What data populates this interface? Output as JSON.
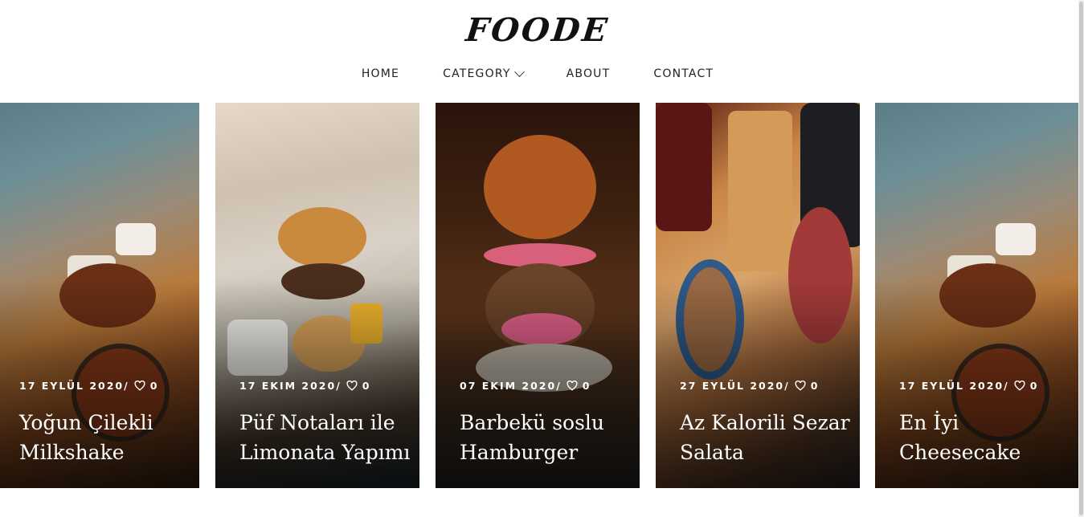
{
  "brand": {
    "logo_text": "FOODE"
  },
  "nav": {
    "items": [
      {
        "label": "HOME"
      },
      {
        "label": "CATEGORY",
        "has_dropdown": true
      },
      {
        "label": "ABOUT"
      },
      {
        "label": "CONTACT"
      }
    ]
  },
  "posts": [
    {
      "date": "17 EYLÜL 2020/",
      "likes": "0",
      "title": "Yoğun Çilekli Milkshake",
      "image": "grilled-steak-platter"
    },
    {
      "date": "17 EKIM 2020/",
      "likes": "0",
      "title": "Püf Notaları ile Limonata Yapımı",
      "image": "burger-with-fries"
    },
    {
      "date": "07 EKIM 2020/",
      "likes": "0",
      "title": "Barbekü soslu Hamburger",
      "image": "tall-burger"
    },
    {
      "date": "27 EYLÜL 2020/",
      "likes": "0",
      "title": "Az Kalorili Sezar Salata",
      "image": "charcuterie-board"
    },
    {
      "date": "17 EYLÜL 2020/",
      "likes": "0",
      "title": "En İyi Cheesecake",
      "image": "grilled-steak-platter"
    }
  ],
  "colors": {
    "text_dark": "#222222",
    "overlay_text": "#ffffff",
    "background": "#ffffff"
  },
  "icons": {
    "likes": "heart-icon",
    "dropdown": "chevron-down-icon"
  }
}
